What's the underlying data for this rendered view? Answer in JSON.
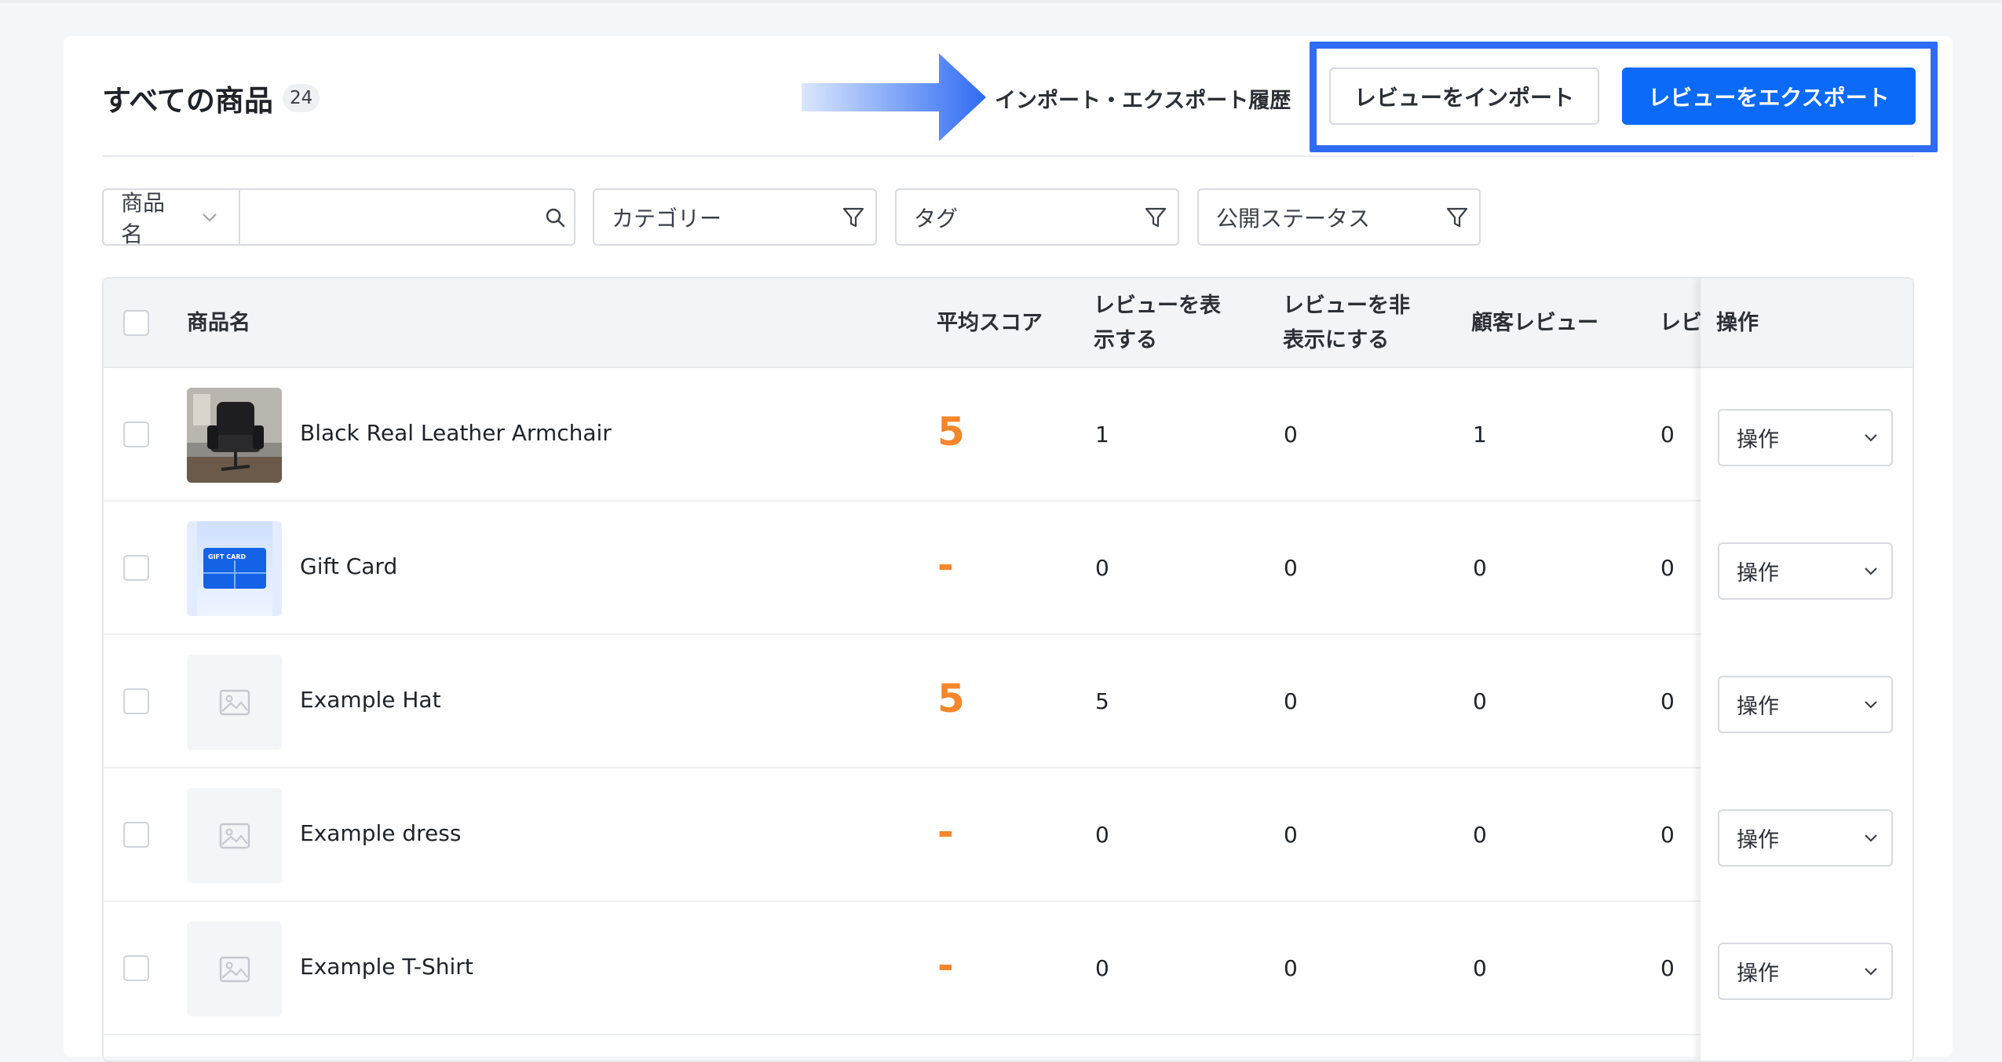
{
  "header": {
    "title": "すべての商品",
    "count": "24",
    "history_link": "インポート・エクスポート履歴",
    "import_button": "レビューをインポート",
    "export_button": "レビューをエクスポート"
  },
  "filters": {
    "name_select": "商品名",
    "search_placeholder": "",
    "category": "カテゴリー",
    "tag": "タグ",
    "status": "公開ステータス"
  },
  "table": {
    "columns": {
      "product": "商品名",
      "avg_score": "平均スコア",
      "shown_1": "レビューを表",
      "shown_2": "示する",
      "hidden_1": "レビューを非",
      "hidden_2": "表示にする",
      "customer": "顧客レビュー",
      "partial": "レビ",
      "actions": "操作"
    },
    "rows": [
      {
        "name": "Black Real Leather Armchair",
        "score": "5",
        "shown": "1",
        "hidden": "0",
        "customer": "1",
        "extra": "0",
        "action": "操作",
        "thumb": "armchair-photo"
      },
      {
        "name": "Gift Card",
        "score": "-",
        "shown": "0",
        "hidden": "0",
        "customer": "0",
        "extra": "0",
        "action": "操作",
        "thumb": "gift-card-image"
      },
      {
        "name": "Example Hat",
        "score": "5",
        "shown": "5",
        "hidden": "0",
        "customer": "0",
        "extra": "0",
        "action": "操作",
        "thumb": "image-placeholder-icon"
      },
      {
        "name": "Example dress",
        "score": "-",
        "shown": "0",
        "hidden": "0",
        "customer": "0",
        "extra": "0",
        "action": "操作",
        "thumb": "image-placeholder-icon"
      },
      {
        "name": "Example T-Shirt",
        "score": "-",
        "shown": "0",
        "hidden": "0",
        "customer": "0",
        "extra": "0",
        "action": "操作",
        "thumb": "image-placeholder-icon"
      }
    ]
  },
  "gift_card_text": "GIFT CARD",
  "colors": {
    "accent": "#0b6af7",
    "highlight": "#2f6bf3",
    "score": "#f5862b"
  }
}
